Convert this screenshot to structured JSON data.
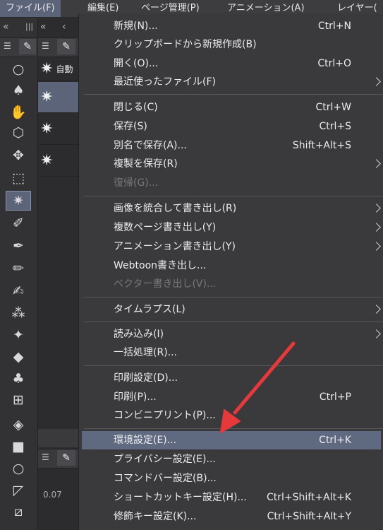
{
  "menubar": {
    "items": [
      {
        "label": "ファイル(F)"
      },
      {
        "label": "編集(E)"
      },
      {
        "label": "ページ管理(P)"
      },
      {
        "label": "アニメーション(A)"
      },
      {
        "label": "レイヤー("
      }
    ]
  },
  "toolbar": {
    "collapse_left": "«",
    "grip": "|||",
    "collapse_right": "«",
    "chevron": "‹"
  },
  "tools": [
    "zoom-icon",
    "hand-palm-icon",
    "hand-icon",
    "3d-object-icon",
    "move-icon",
    "selection-rect-icon",
    "auto-select-icon",
    "eyedropper-icon",
    "pen-icon",
    "pencil-icon",
    "brush-icon",
    "airbrush-icon",
    "decoration-icon",
    "eraser-icon",
    "blend-icon",
    "frame-border-icon",
    "fill-icon",
    "gradient-icon",
    "figure-icon",
    "ruler-icon",
    "text-icon"
  ],
  "subtools": {
    "items": [
      {
        "label": "自動"
      },
      {
        "label": ""
      },
      {
        "label": ""
      },
      {
        "label": ""
      }
    ]
  },
  "bottom_panel": {
    "value": "0.07"
  },
  "file_menu": {
    "items": [
      {
        "label": "新規(N)...",
        "shortcut": "Ctrl+N"
      },
      {
        "label": "クリップボードから新規作成(B)",
        "shortcut": ""
      },
      {
        "label": "開く(O)...",
        "shortcut": "Ctrl+O"
      },
      {
        "label": "最近使ったファイル(F)",
        "shortcut": ""
      },
      {
        "label": "閉じる(C)",
        "shortcut": "Ctrl+W"
      },
      {
        "label": "保存(S)",
        "shortcut": "Ctrl+S"
      },
      {
        "label": "別名で保存(A)...",
        "shortcut": "Shift+Alt+S"
      },
      {
        "label": "複製を保存(R)",
        "shortcut": ""
      },
      {
        "label": "復帰(G)...",
        "shortcut": ""
      },
      {
        "label": "画像を統合して書き出し(R)",
        "shortcut": ""
      },
      {
        "label": "複数ページ書き出し(Y)",
        "shortcut": ""
      },
      {
        "label": "アニメーション書き出し(Y)",
        "shortcut": ""
      },
      {
        "label": "Webtoon書き出し...",
        "shortcut": ""
      },
      {
        "label": "ベクター書き出し(V)...",
        "shortcut": ""
      },
      {
        "label": "タイムラプス(L)",
        "shortcut": ""
      },
      {
        "label": "読み込み(I)",
        "shortcut": ""
      },
      {
        "label": "一括処理(R)...",
        "shortcut": ""
      },
      {
        "label": "印刷設定(D)...",
        "shortcut": ""
      },
      {
        "label": "印刷(P)...",
        "shortcut": "Ctrl+P"
      },
      {
        "label": "コンビニプリント(P)...",
        "shortcut": ""
      },
      {
        "label": "環境設定(E)...",
        "shortcut": "Ctrl+K"
      },
      {
        "label": "プライバシー設定(E)...",
        "shortcut": ""
      },
      {
        "label": "コマンドバー設定(B)...",
        "shortcut": ""
      },
      {
        "label": "ショートカットキー設定(H)...",
        "shortcut": "Ctrl+Shift+Alt+K"
      },
      {
        "label": "修飾キー設定(K)...",
        "shortcut": "Ctrl+Shift+Alt+Y"
      }
    ]
  },
  "colors": {
    "menu_bg": "#3a3a3c",
    "highlight": "#5f6a80",
    "annotation_arrow": "#e8393a"
  }
}
